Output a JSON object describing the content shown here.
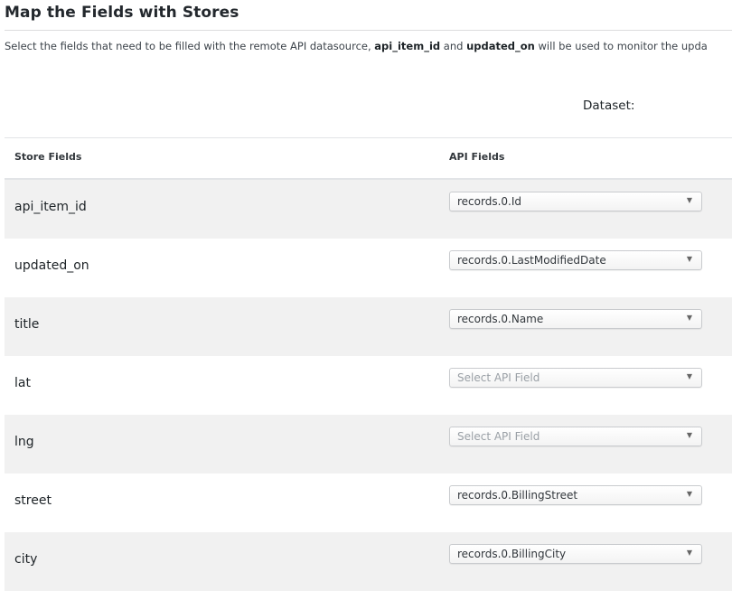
{
  "header": {
    "title": "Map the Fields with Stores",
    "description": {
      "before": "Select the fields that need to be filled with the remote API datasource, ",
      "field1": "api_item_id",
      "middle": " and ",
      "field2": "updated_on",
      "after": " will be used to monitor the upda"
    },
    "dataset_label": "Dataset:"
  },
  "table": {
    "columns": {
      "store": "Store Fields",
      "api": "API Fields"
    },
    "rows": [
      {
        "store_field": "api_item_id",
        "api_field": "records.0.Id",
        "is_placeholder": false
      },
      {
        "store_field": "updated_on",
        "api_field": "records.0.LastModifiedDate",
        "is_placeholder": false
      },
      {
        "store_field": "title",
        "api_field": "records.0.Name",
        "is_placeholder": false
      },
      {
        "store_field": "lat",
        "api_field": "Select API Field",
        "is_placeholder": true
      },
      {
        "store_field": "lng",
        "api_field": "Select API Field",
        "is_placeholder": true
      },
      {
        "store_field": "street",
        "api_field": "records.0.BillingStreet",
        "is_placeholder": false
      },
      {
        "store_field": "city",
        "api_field": "records.0.BillingCity",
        "is_placeholder": false
      }
    ],
    "caret_icon": "▼"
  },
  "colors": {
    "alt_row_bg": "#f1f1f1",
    "placeholder_text": "#9aa0a6"
  }
}
